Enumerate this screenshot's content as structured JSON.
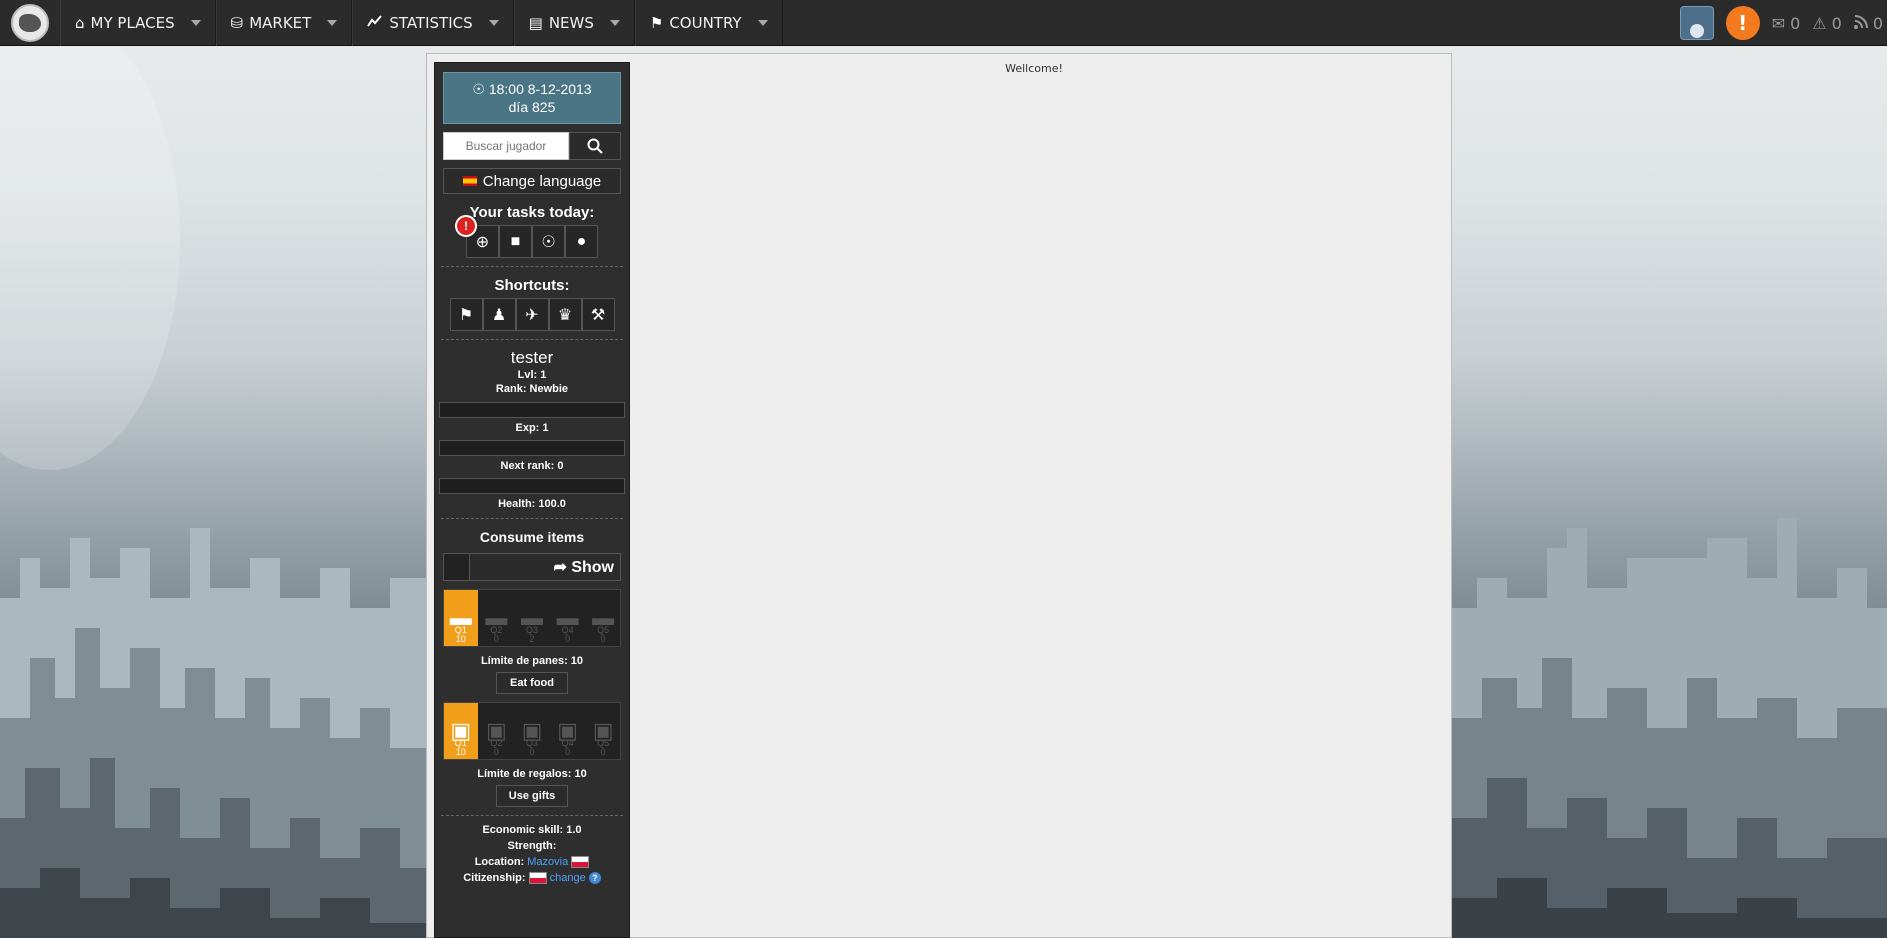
{
  "topbar": {
    "nav": [
      {
        "label": "MY PLACES",
        "icon": "home-icon"
      },
      {
        "label": "MARKET",
        "icon": "coins-icon"
      },
      {
        "label": "STATISTICS",
        "icon": "chart-line-icon"
      },
      {
        "label": "NEWS",
        "icon": "newspaper-icon"
      },
      {
        "label": "COUNTRY",
        "icon": "flag-icon"
      }
    ],
    "messages_count": "0",
    "alerts_count": "0",
    "feed_count": "0"
  },
  "main": {
    "welcome_text": "Wellcome!"
  },
  "sidebar": {
    "datetime": "18:00 8-12-2013",
    "day": "día 825",
    "search_placeholder": "Buscar jugador",
    "change_language": "Change language",
    "tasks_title": "Your tasks today:",
    "tasks_badge": "!",
    "shortcuts_title": "Shortcuts:",
    "username": "tester",
    "level": "Lvl: 1",
    "rank": "Rank: Newbie",
    "exp": "Exp:  1",
    "next_rank": "Next rank:  0",
    "health": "Health:  100.0",
    "consume_title": "Consume items",
    "show_label": "Show",
    "food_items": [
      {
        "q": "Q1",
        "n": "10",
        "active": true
      },
      {
        "q": "Q2",
        "n": "0",
        "active": false
      },
      {
        "q": "Q3",
        "n": "2",
        "active": false
      },
      {
        "q": "Q4",
        "n": "0",
        "active": false
      },
      {
        "q": "Q5",
        "n": "0",
        "active": false
      }
    ],
    "food_limit": "Límite de panes: 10",
    "eat_button": "Eat food",
    "gift_items": [
      {
        "q": "Q1",
        "n": "10",
        "active": true
      },
      {
        "q": "Q2",
        "n": "0",
        "active": false
      },
      {
        "q": "Q3",
        "n": "0",
        "active": false
      },
      {
        "q": "Q4",
        "n": "0",
        "active": false
      },
      {
        "q": "Q5",
        "n": "0",
        "active": false
      }
    ],
    "gift_limit": "Límite de regalos: 10",
    "gift_button": "Use gifts",
    "economic_skill": "Economic skill: 1.0",
    "strength": "Strength:",
    "location_label": "Location:",
    "location_value": "Mazovia",
    "citizenship_label": "Citizenship:",
    "citizenship_link": "change",
    "colors": {
      "accent": "#f19e1b",
      "date_box": "#4a7585",
      "topbar": "#2b2b2b"
    }
  }
}
